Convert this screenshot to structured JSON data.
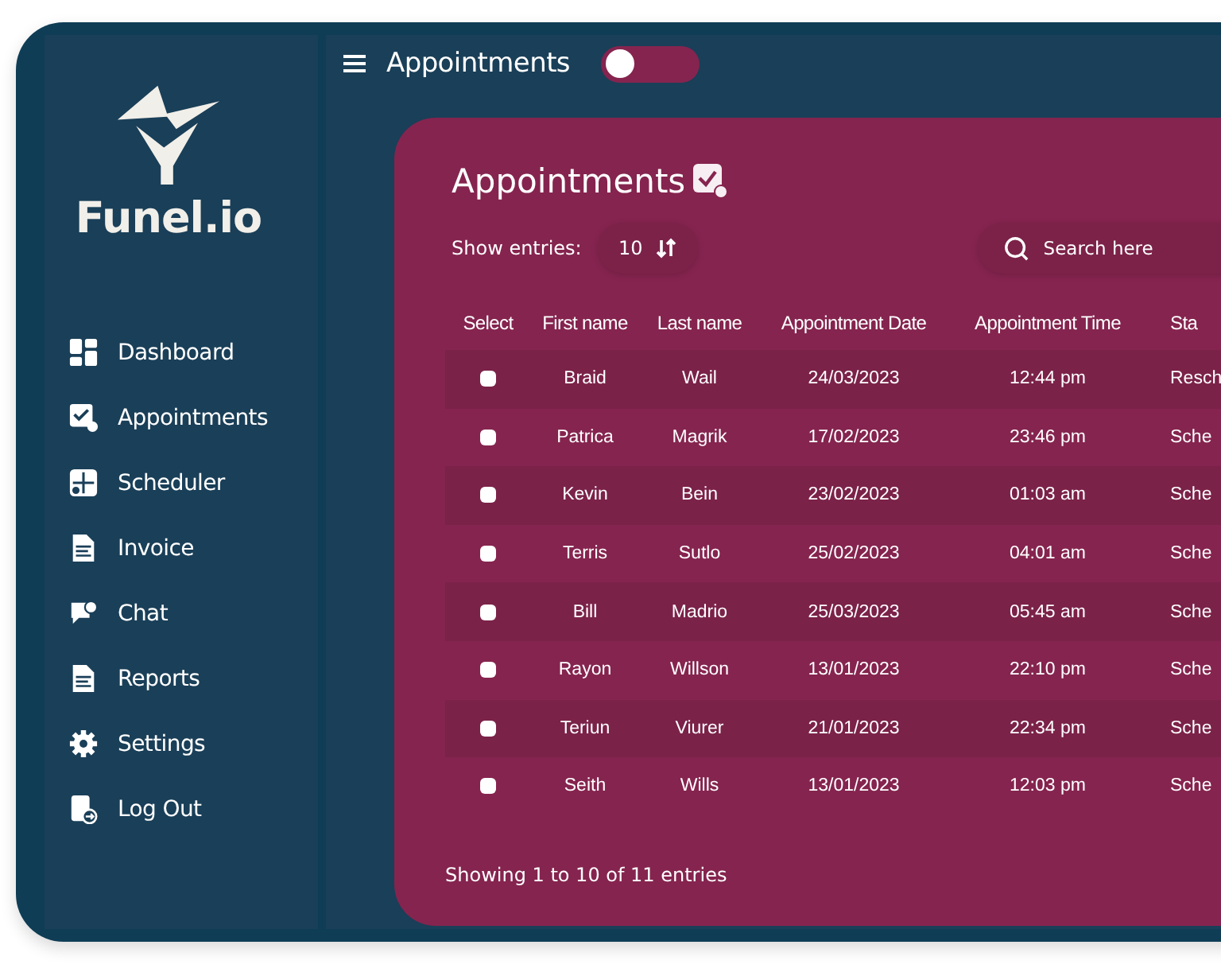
{
  "sidebar": {
    "logo_text": "Funel.io",
    "items": [
      {
        "label": "Dashboard"
      },
      {
        "label": "Appointments"
      },
      {
        "label": "Scheduler"
      },
      {
        "label": "Invoice"
      },
      {
        "label": "Chat"
      },
      {
        "label": "Reports"
      },
      {
        "label": "Settings"
      },
      {
        "label": "Log Out"
      }
    ]
  },
  "topbar": {
    "title": "Appointments",
    "toggle": {
      "on": false
    }
  },
  "card": {
    "title": "Appointments",
    "show_entries_label": "Show entries:",
    "entries_value": "10",
    "search": {
      "placeholder": "Search here"
    },
    "table": {
      "select_column": "Select",
      "columns": [
        "First name",
        "Last name",
        "Appointment Date",
        "Appointment Time",
        "Sta"
      ],
      "rows": [
        {
          "checked": false,
          "cells": [
            "Braid",
            "Wail",
            "24/03/2023",
            "12:44 pm",
            "Resch"
          ]
        },
        {
          "checked": false,
          "cells": [
            "Patrica",
            "Magrik",
            "17/02/2023",
            "23:46 pm",
            "Sche"
          ]
        },
        {
          "checked": false,
          "cells": [
            "Kevin",
            "Bein",
            "23/02/2023",
            "01:03 am",
            "Sche"
          ]
        },
        {
          "checked": false,
          "cells": [
            "Terris",
            "Sutlo",
            "25/02/2023",
            "04:01 am",
            "Sche"
          ]
        },
        {
          "checked": false,
          "cells": [
            "Bill",
            "Madrio",
            "25/03/2023",
            "05:45 am",
            "Sche"
          ]
        },
        {
          "checked": false,
          "cells": [
            "Rayon",
            "Willson",
            "13/01/2023",
            "22:10 pm",
            "Sche"
          ]
        },
        {
          "checked": false,
          "cells": [
            "Teriun",
            "Viurer",
            "21/01/2023",
            "22:34 pm",
            "Sche"
          ]
        },
        {
          "checked": false,
          "cells": [
            "Seith",
            "Wills",
            "13/01/2023",
            "12:03 pm",
            "Sche"
          ]
        }
      ]
    },
    "footer": "Showing 1 to 10 of 11 entries"
  }
}
